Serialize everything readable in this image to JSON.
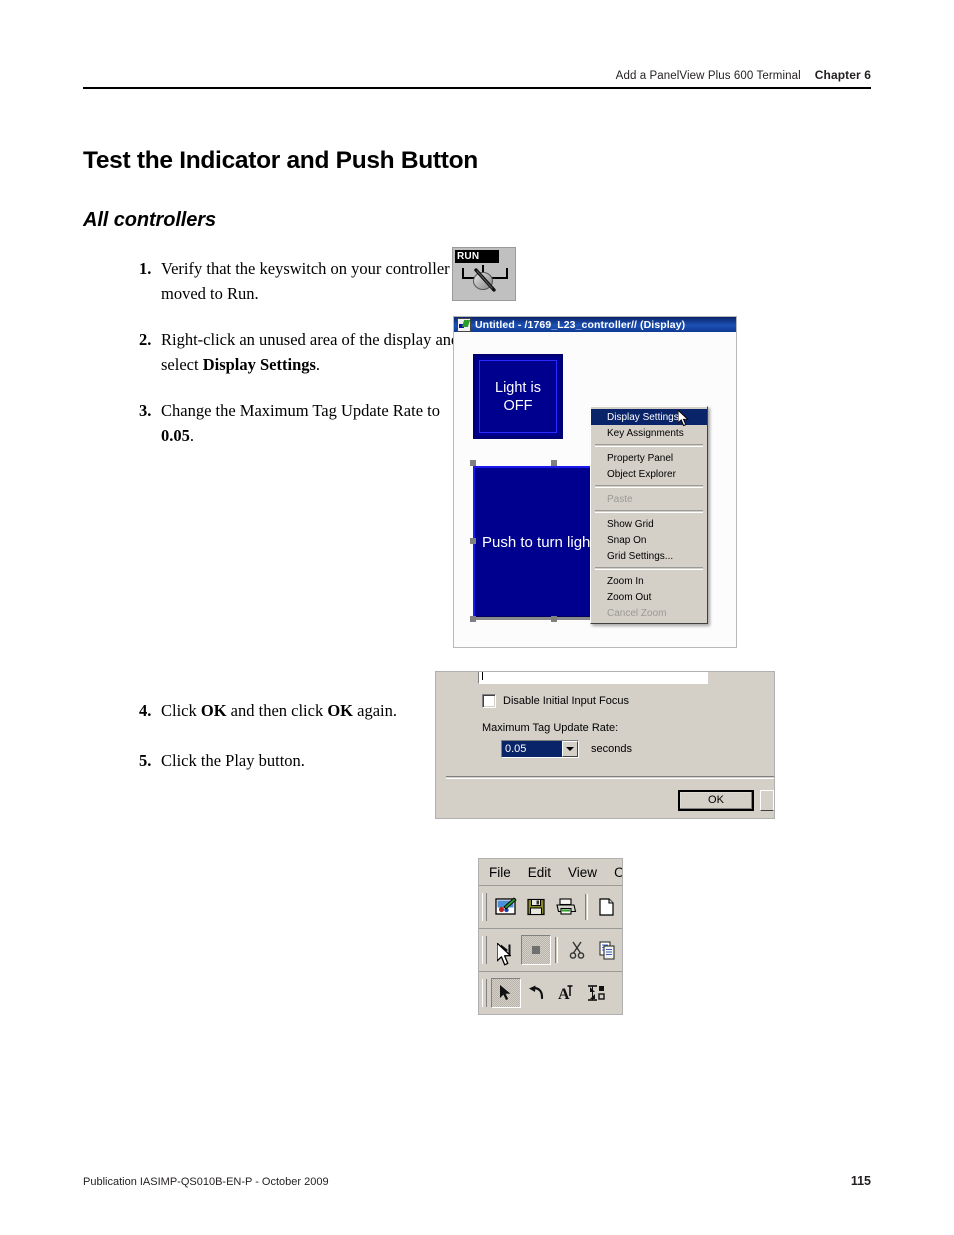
{
  "header": {
    "running_head": "Add a PanelView Plus 600 Terminal",
    "chapter": "Chapter 6"
  },
  "title": "Test the Indicator and Push Button",
  "subtitle": "All controllers",
  "steps": [
    {
      "num": "1.",
      "parts": [
        {
          "t": "Verify that the keyswitch on your controller is moved to Run.",
          "b": false
        }
      ]
    },
    {
      "num": "2.",
      "parts": [
        {
          "t": "Right-click an unused area of the display and select ",
          "b": false
        },
        {
          "t": "Display Settings",
          "b": true
        },
        {
          "t": ".",
          "b": false
        }
      ]
    },
    {
      "num": "3.",
      "parts": [
        {
          "t": "Change the Maximum Tag Update Rate to ",
          "b": false
        },
        {
          "t": "0.05",
          "b": true
        },
        {
          "t": ".",
          "b": false
        }
      ]
    }
  ],
  "steps_late": [
    {
      "num": "4.",
      "parts": [
        {
          "t": "Click ",
          "b": false
        },
        {
          "t": "OK",
          "b": true
        },
        {
          "t": " and then click ",
          "b": false
        },
        {
          "t": "OK",
          "b": true
        },
        {
          "t": " again.",
          "b": false
        }
      ]
    },
    {
      "num": "5.",
      "parts": [
        {
          "t": "Click the Play button.",
          "b": false
        }
      ]
    }
  ],
  "keyswitch": {
    "label": "RUN"
  },
  "display_window": {
    "title": "Untitled - /1769_L23_controller// (Display)",
    "indicator_text": "Light is\nOFF",
    "indicator_line1": "Light is",
    "indicator_line2": "OFF",
    "button_text": "Push to turn light",
    "object_color": "#00008f",
    "highlight_color": "#1a1aee",
    "titlebar_color": "#0a246a"
  },
  "context_menu": {
    "items": [
      {
        "label": "Display Settings...",
        "state": "selected"
      },
      {
        "label": "Key Assignments",
        "state": "normal"
      },
      {
        "label": "",
        "state": "separator"
      },
      {
        "label": "Property Panel",
        "state": "normal"
      },
      {
        "label": "Object Explorer",
        "state": "normal"
      },
      {
        "label": "",
        "state": "separator"
      },
      {
        "label": "Paste",
        "state": "disabled"
      },
      {
        "label": "",
        "state": "separator"
      },
      {
        "label": "Show Grid",
        "state": "normal"
      },
      {
        "label": "Snap On",
        "state": "normal"
      },
      {
        "label": "Grid Settings...",
        "state": "normal"
      },
      {
        "label": "",
        "state": "separator"
      },
      {
        "label": "Zoom In",
        "state": "normal"
      },
      {
        "label": "Zoom Out",
        "state": "normal"
      },
      {
        "label": "Cancel Zoom",
        "state": "disabled"
      }
    ]
  },
  "settings_dialog": {
    "checkbox_label": "Disable Initial Input Focus",
    "checkbox_checked": false,
    "rate_label": "Maximum Tag Update Rate:",
    "rate_value": "0.05",
    "units_label": "seconds",
    "ok_label": "OK"
  },
  "toolbar_window": {
    "menus": [
      "File",
      "Edit",
      "View",
      "O"
    ],
    "row1_icons": [
      "new-display-icon",
      "save-icon",
      "print-icon",
      "new-document-icon"
    ],
    "row2_icons": [
      "play-icon",
      "stop-icon",
      "cut-icon",
      "copy-icon"
    ],
    "row3_icons": [
      "select-arrow-icon",
      "undo-icon",
      "text-tool-icon",
      "align-tool-icon"
    ]
  },
  "footer": {
    "publication": "Publication IASIMP-QS010B-EN-P - October 2009",
    "page_number": "115"
  }
}
